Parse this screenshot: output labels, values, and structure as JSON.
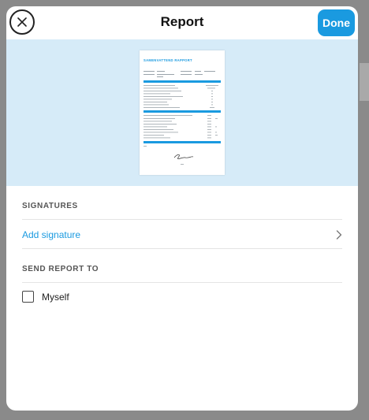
{
  "header": {
    "title": "Report",
    "done_label": "Done",
    "close_icon": "close-icon"
  },
  "preview": {
    "document_title": "SAMENVATTEND RAPPORT"
  },
  "signatures": {
    "section_label": "SIGNATURES",
    "add_label": "Add signature",
    "chevron_icon": "chevron-right-icon"
  },
  "send_to": {
    "section_label": "SEND REPORT TO",
    "options": [
      {
        "label": "Myself",
        "checked": false
      }
    ]
  },
  "colors": {
    "accent": "#1a9ae0",
    "preview_bg": "#d6ebf8"
  }
}
